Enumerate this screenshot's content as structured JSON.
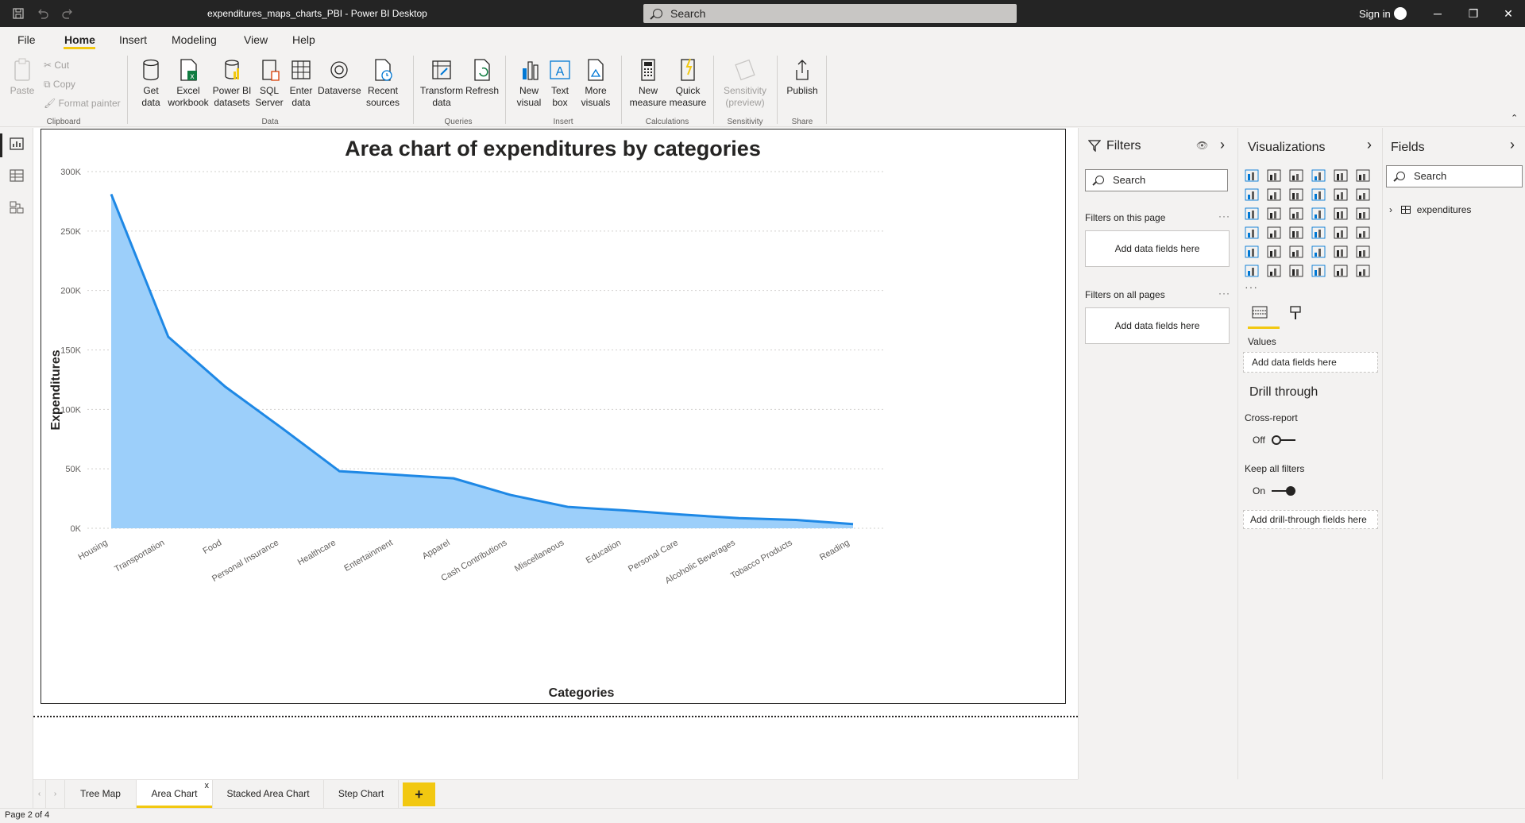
{
  "titlebar": {
    "document_title": "expenditures_maps_charts_PBI - Power BI Desktop",
    "search_placeholder": "Search",
    "signin_label": "Sign in"
  },
  "menu": {
    "items": [
      "File",
      "Home",
      "Insert",
      "Modeling",
      "View",
      "Help"
    ],
    "active": "Home"
  },
  "ribbon": {
    "clipboard": {
      "paste": "Paste",
      "cut": "Cut",
      "copy": "Copy",
      "format_painter": "Format painter",
      "group": "Clipboard"
    },
    "data": {
      "get_data": [
        "Get",
        "data"
      ],
      "excel": [
        "Excel",
        "workbook"
      ],
      "pbi_datasets": [
        "Power BI",
        "datasets"
      ],
      "sql": [
        "SQL",
        "Server"
      ],
      "enter": [
        "Enter",
        "data"
      ],
      "dataverse": "Dataverse",
      "recent": [
        "Recent",
        "sources"
      ],
      "group": "Data"
    },
    "queries": {
      "transform": [
        "Transform",
        "data"
      ],
      "refresh": "Refresh",
      "group": "Queries"
    },
    "insert": {
      "new_visual": [
        "New",
        "visual"
      ],
      "text_box": [
        "Text",
        "box"
      ],
      "more_visuals": [
        "More",
        "visuals"
      ],
      "group": "Insert"
    },
    "calculations": {
      "new_measure": [
        "New",
        "measure"
      ],
      "quick_measure": [
        "Quick",
        "measure"
      ],
      "group": "Calculations"
    },
    "sensitivity": {
      "label": [
        "Sensitivity",
        "(preview)"
      ],
      "group": "Sensitivity"
    },
    "share": {
      "publish": "Publish",
      "group": "Share"
    }
  },
  "chart_data": {
    "type": "area",
    "title": "Area chart of expenditures by categories",
    "xlabel": "Categories",
    "ylabel": "Expenditures",
    "categories": [
      "Housing",
      "Transportation",
      "Food",
      "Personal Insurance",
      "Healthcare",
      "Entertainment",
      "Apparel",
      "Cash Contributions",
      "Miscellaneous",
      "Education",
      "Personal Care",
      "Alcoholic Beverages",
      "Tobacco Products",
      "Reading"
    ],
    "values": [
      281000,
      161000,
      119000,
      84000,
      48000,
      45000,
      42000,
      28000,
      18000,
      15000,
      11500,
      8500,
      7000,
      3500
    ],
    "ylim": [
      0,
      300000
    ],
    "yticks": [
      0,
      50000,
      100000,
      150000,
      200000,
      250000,
      300000
    ],
    "ytick_labels": [
      "0K",
      "50K",
      "100K",
      "150K",
      "200K",
      "250K",
      "300K"
    ],
    "grid": true,
    "colors": {
      "fill": "#9ccffa",
      "line": "#1e88e5"
    }
  },
  "filters": {
    "title": "Filters",
    "search_placeholder": "Search",
    "on_this_page": "Filters on this page",
    "on_all_pages": "Filters on all pages",
    "well_text": "Add data fields here"
  },
  "visualizations": {
    "title": "Visualizations",
    "values_label": "Values",
    "values_well": "Add data fields here",
    "drill_through": "Drill through",
    "cross_report": "Cross-report",
    "cross_report_state": "Off",
    "keep_filters": "Keep all filters",
    "keep_filters_state": "On",
    "drill_well": "Add drill-through fields here"
  },
  "fields": {
    "title": "Fields",
    "search_placeholder": "Search",
    "tables": [
      "expenditures"
    ]
  },
  "tabs": {
    "pages": [
      "Tree Map",
      "Area Chart",
      "Stacked Area Chart",
      "Step Chart"
    ],
    "active": "Area Chart",
    "close": "x",
    "add": "+"
  },
  "status": {
    "page_indicator": "Page 2 of 4"
  },
  "colors": {
    "accent": "#f2c811",
    "titlebar": "#242424"
  }
}
